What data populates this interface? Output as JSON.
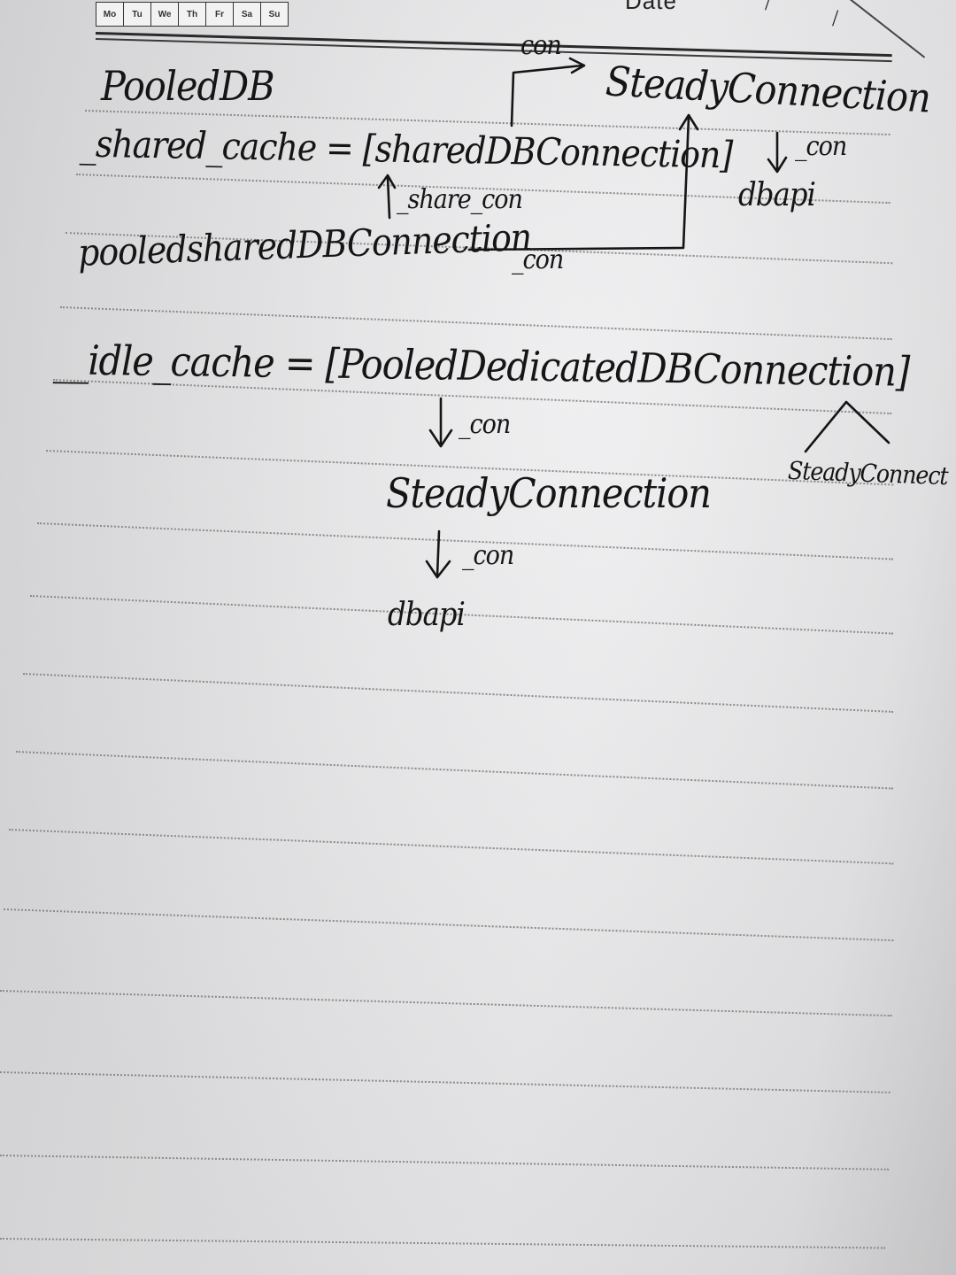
{
  "header": {
    "days": [
      "Mo",
      "Tu",
      "We",
      "Th",
      "Fr",
      "Sa",
      "Su"
    ],
    "date_label": "Date",
    "date_separators": [
      "/",
      "/"
    ]
  },
  "notes": {
    "title": "PooledDB",
    "shared_cache": "_shared_cache = [sharedDBConnection]",
    "con_top": "con",
    "steady_top": "SteadyConnection",
    "con_right": "_con",
    "dbapi_top": "dbapi",
    "share_con": "_share_con",
    "pooled_shared": "pooledsharedDBConnection",
    "con_mid": "_con",
    "idle_cache": "__idle_cache = [PooledDedicatedDBConnection]",
    "con_idle": "_con",
    "steady_bottom": "SteadyConnection",
    "steady_side": "SteadyConnect",
    "con_bottom": "_con",
    "dbapi_bottom": "dbapi"
  }
}
